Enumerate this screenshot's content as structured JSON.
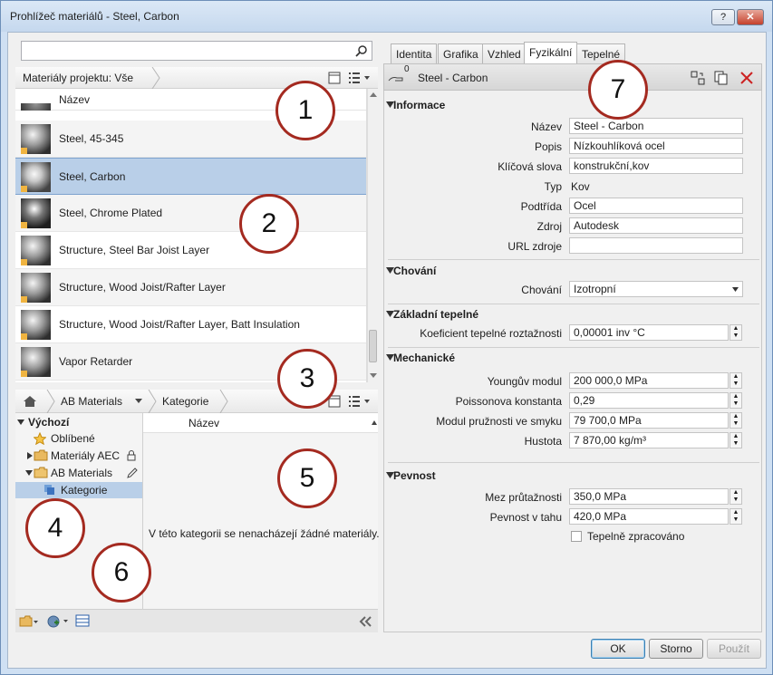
{
  "window": {
    "title": "Prohlížeč materiálů - Steel, Carbon",
    "help_label": "?",
    "close_label": "✕"
  },
  "library_panel": {
    "search_placeholder": "",
    "breadcrumb": "Materiály projektu: Vše",
    "column_header": "Název",
    "materials": [
      {
        "name": "Steel, 45-345",
        "selected": false
      },
      {
        "name": "Steel, Carbon",
        "selected": true
      },
      {
        "name": "Steel, Chrome Plated",
        "selected": false
      },
      {
        "name": "Structure, Steel Bar Joist Layer",
        "selected": false
      },
      {
        "name": "Structure, Wood Joist/Rafter Layer",
        "selected": false
      },
      {
        "name": "Structure, Wood Joist/Rafter Layer, Batt Insulation",
        "selected": false
      },
      {
        "name": "Vapor Retarder",
        "selected": false
      }
    ]
  },
  "browser_panel": {
    "breadcrumb": [
      "AB Materials",
      "Kategorie"
    ],
    "tree": {
      "root": "Výchozí",
      "favorites": "Oblíbené",
      "aec": "Materiály AEC",
      "ab": "AB Materials",
      "category": "Kategorie"
    },
    "column_header": "Název",
    "empty_message": "V této kategorii se nenacházejí žádné materiály."
  },
  "editor": {
    "tabs": [
      "Identita",
      "Grafika",
      "Vzhled",
      "Fyzikální",
      "Tepelné"
    ],
    "active_tab": "Fyzikální",
    "asset_count": "0",
    "asset_name": "Steel - Carbon",
    "sections": {
      "info": {
        "title": "Informace",
        "name_label": "Název",
        "name_value": "Steel - Carbon",
        "desc_label": "Popis",
        "desc_value": "Nízkouhlíková ocel",
        "keywords_label": "Klíčová slova",
        "keywords_value": "konstrukční,kov",
        "type_label": "Typ",
        "type_value": "Kov",
        "subclass_label": "Podtřída",
        "subclass_value": "Ocel",
        "source_label": "Zdroj",
        "source_value": "Autodesk",
        "url_label": "URL zdroje",
        "url_value": ""
      },
      "behavior": {
        "title": "Chování",
        "label": "Chování",
        "value": "Izotropní"
      },
      "thermal": {
        "title": "Základní tepelné",
        "label": "Koeficient tepelné roztažnosti",
        "value": "0,00001 inv °C"
      },
      "mechanical": {
        "title": "Mechanické",
        "young_label": "Youngův modul",
        "young_value": "200 000,0 MPa",
        "poisson_label": "Poissonova konstanta",
        "poisson_value": "0,29",
        "shear_label": "Modul pružnosti ve smyku",
        "shear_value": "79 700,0 MPa",
        "density_label": "Hustota",
        "density_value": "7 870,00 kg/m³"
      },
      "strength": {
        "title": "Pevnost",
        "yield_label": "Mez průtažnosti",
        "yield_value": "350,0 MPa",
        "tensile_label": "Pevnost v tahu",
        "tensile_value": "420,0 MPa",
        "heat_treated_label": "Tepelně zpracováno"
      }
    }
  },
  "buttons": {
    "ok": "OK",
    "cancel": "Storno",
    "apply": "Použít"
  },
  "callouts": [
    "1",
    "2",
    "3",
    "4",
    "5",
    "6",
    "7"
  ],
  "colors": {
    "callout_ring": "#a42a20",
    "selection": "#b9cfe8",
    "delete": "#cc2222"
  }
}
